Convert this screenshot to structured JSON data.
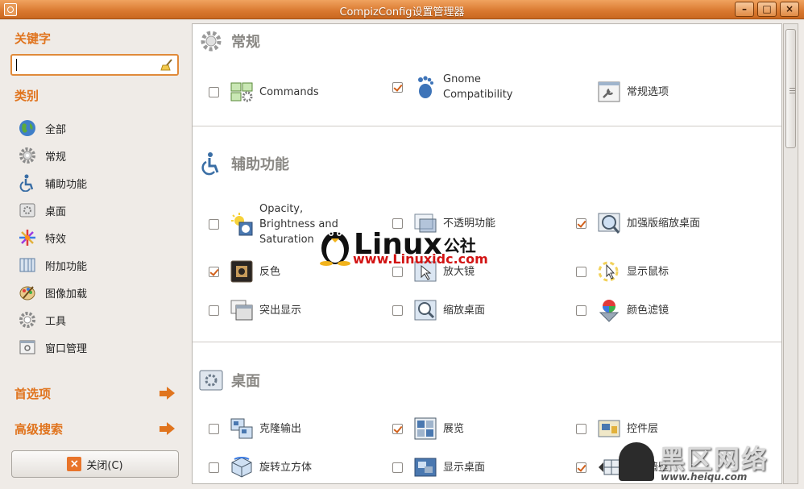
{
  "window": {
    "title": "CompizConfig设置管理器",
    "buttons": {
      "minimize": "–",
      "maximize": "□",
      "close": "×"
    }
  },
  "sidebar": {
    "keyword_heading": "关键字",
    "search_value": "",
    "category_heading": "类别",
    "categories": [
      {
        "label": "全部",
        "icon": "globe-icon"
      },
      {
        "label": "常规",
        "icon": "gear-icon"
      },
      {
        "label": "辅助功能",
        "icon": "accessibility-icon"
      },
      {
        "label": "桌面",
        "icon": "desktop-icon"
      },
      {
        "label": "特效",
        "icon": "effects-icon"
      },
      {
        "label": "附加功能",
        "icon": "extras-icon"
      },
      {
        "label": "图像加载",
        "icon": "image-loading-icon"
      },
      {
        "label": "工具",
        "icon": "utility-icon"
      },
      {
        "label": "窗口管理",
        "icon": "window-management-icon"
      }
    ],
    "preferences_label": "首选项",
    "advanced_search_label": "高级搜索",
    "close_label": "关闭(C)"
  },
  "groups": [
    {
      "title": "常规",
      "plugins": [
        {
          "label": "Commands",
          "checked": false,
          "icon": "commands-icon"
        },
        {
          "label": "Gnome\nCompatibility",
          "checked": true,
          "icon": "gnome-foot-icon"
        },
        {
          "label": "常规选项",
          "checked": false,
          "icon": "general-options-icon"
        }
      ]
    },
    {
      "title": "辅助功能",
      "plugins": [
        {
          "label": "Opacity,\nBrightness and\nSaturation",
          "checked": false,
          "icon": "brightness-icon"
        },
        {
          "label": "不透明功能",
          "checked": false,
          "icon": "opacity-icon"
        },
        {
          "label": "加强版缩放桌面",
          "checked": true,
          "icon": "enhanced-zoom-icon"
        },
        {
          "label": "反色",
          "checked": true,
          "icon": "negative-icon"
        },
        {
          "label": "放大镜",
          "checked": false,
          "icon": "magnifier-icon"
        },
        {
          "label": "显示鼠标",
          "checked": false,
          "icon": "show-mouse-icon"
        },
        {
          "label": "突出显示",
          "checked": false,
          "icon": "highlight-icon"
        },
        {
          "label": "缩放桌面",
          "checked": false,
          "icon": "zoom-desktop-icon"
        },
        {
          "label": "颜色滤镜",
          "checked": false,
          "icon": "color-filter-icon"
        }
      ]
    },
    {
      "title": "桌面",
      "plugins": [
        {
          "label": "克隆输出",
          "checked": false,
          "icon": "clone-output-icon"
        },
        {
          "label": "展览",
          "checked": true,
          "icon": "expo-icon"
        },
        {
          "label": "控件层",
          "checked": false,
          "icon": "widget-layer-icon"
        },
        {
          "label": "旋转立方体",
          "checked": false,
          "icon": "rotate-cube-icon"
        },
        {
          "label": "显示桌面",
          "checked": false,
          "icon": "show-desktop-icon"
        },
        {
          "label": "桌面墙壁",
          "checked": true,
          "icon": "desktop-wall-icon"
        }
      ]
    }
  ],
  "watermarks": {
    "linux_text": "Linux",
    "linux_cn": "公社",
    "linux_url": "www.Linuxidc.com",
    "heiqu_cn": "黑区网络",
    "heiqu_url": "www.heiqu.com"
  },
  "colors": {
    "accent": "#e0741e",
    "titlebar": "#d9782f",
    "check": "#d2601a"
  }
}
